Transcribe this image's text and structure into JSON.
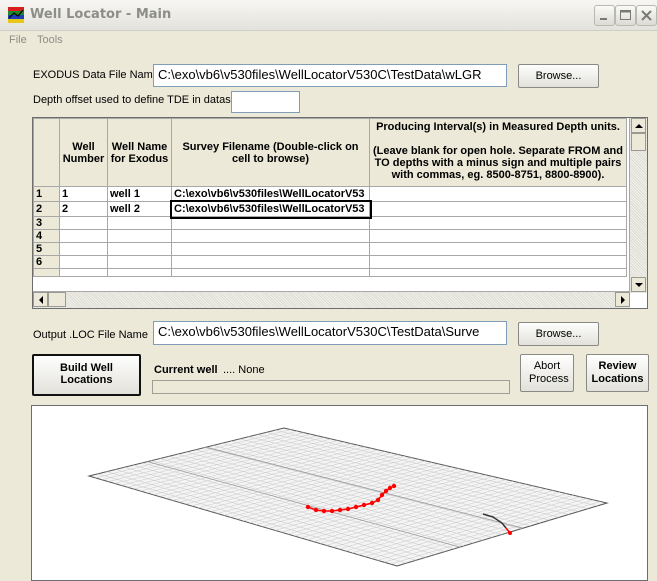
{
  "window": {
    "title": "Well Locator - Main",
    "menu": [
      "File",
      "Tools"
    ]
  },
  "form": {
    "exodus_label": "EXODUS Data File Name",
    "exodus_value": "C:\\exo\\vb6\\v530files\\WellLocatorV530C\\TestData\\wLGR",
    "browse_label": "Browse...",
    "depth_offset_label": "Depth offset used to define TDE in dataset",
    "depth_offset_value": "",
    "output_label": "Output .LOC File Name",
    "output_value": "C:\\exo\\vb6\\v530files\\WellLocatorV530C\\TestData\\Surve",
    "output_browse_label": "Browse..."
  },
  "grid": {
    "headers": {
      "well_number": "Well Number",
      "well_name": "Well Name for Exodus",
      "survey": "Survey Filename (Double-click on cell to browse)",
      "producing_title": "Producing Interval(s) in Measured Depth units.",
      "producing_note": "(Leave blank for open hole. Separate FROM and TO depths with a minus sign and multiple pairs with commas, eg. 8500-8751, 8800-8900)."
    },
    "rows": [
      {
        "row": "1",
        "number": "1",
        "name": "well 1",
        "survey": "C:\\exo\\vb6\\v530files\\WellLocatorV53",
        "interval": ""
      },
      {
        "row": "2",
        "number": "2",
        "name": "well 2",
        "survey": "C:\\exo\\vb6\\v530files\\WellLocatorV53",
        "interval": ""
      },
      {
        "row": "3",
        "number": "",
        "name": "",
        "survey": "",
        "interval": ""
      },
      {
        "row": "4",
        "number": "",
        "name": "",
        "survey": "",
        "interval": ""
      },
      {
        "row": "5",
        "number": "",
        "name": "",
        "survey": "",
        "interval": ""
      },
      {
        "row": "6",
        "number": "",
        "name": "",
        "survey": "",
        "interval": ""
      },
      {
        "row": "",
        "number": "",
        "name": "",
        "survey": "",
        "interval": ""
      }
    ]
  },
  "actions": {
    "build_label": "Build Well Locations",
    "current_well_label": "Current well",
    "current_well_value": ".... None",
    "abort_label": "Abort Process",
    "review_label": "Review Locations",
    "progress": 0
  },
  "colors": {
    "well_path": "#ff0000",
    "well_path_dark": "#333333",
    "grid_line": "#c8c8c8"
  }
}
